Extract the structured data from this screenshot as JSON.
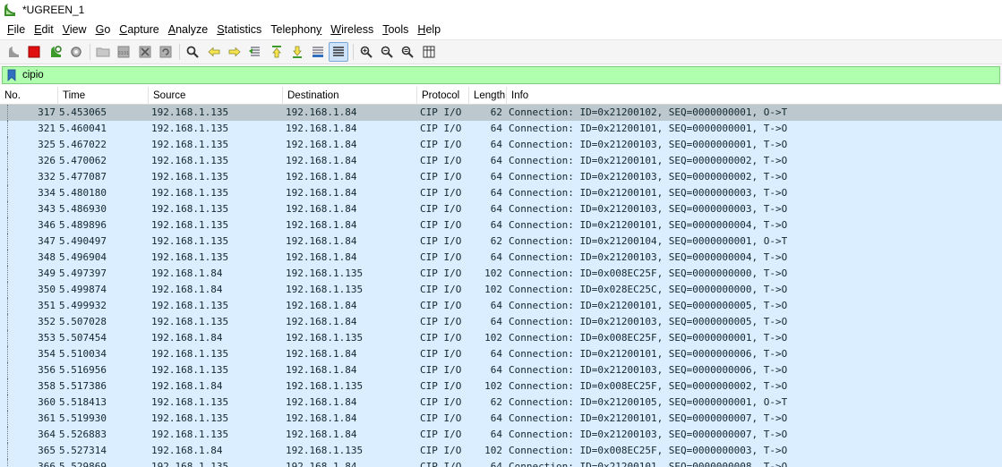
{
  "window": {
    "title": "*UGREEN_1"
  },
  "menu": [
    {
      "pre": "",
      "mn": "F",
      "post": "ile"
    },
    {
      "pre": "",
      "mn": "E",
      "post": "dit"
    },
    {
      "pre": "",
      "mn": "V",
      "post": "iew"
    },
    {
      "pre": "",
      "mn": "G",
      "post": "o"
    },
    {
      "pre": "",
      "mn": "C",
      "post": "apture"
    },
    {
      "pre": "",
      "mn": "A",
      "post": "nalyze"
    },
    {
      "pre": "",
      "mn": "S",
      "post": "tatistics"
    },
    {
      "pre": "Telephon",
      "mn": "y",
      "post": ""
    },
    {
      "pre": "",
      "mn": "W",
      "post": "ireless"
    },
    {
      "pre": "",
      "mn": "T",
      "post": "ools"
    },
    {
      "pre": "",
      "mn": "H",
      "post": "elp"
    }
  ],
  "toolbar": {
    "buttons": [
      "start-capture-icon",
      "stop-capture-icon",
      "restart-capture-icon",
      "capture-options-icon",
      "|",
      "open-file-icon",
      "save-file-icon",
      "close-file-icon",
      "reload-file-icon",
      "|",
      "find-packet-icon",
      "go-back-icon",
      "go-forward-icon",
      "go-to-packet-icon",
      "go-first-icon",
      "go-last-icon",
      "autoscroll-icon",
      "colorize-icon",
      "|",
      "zoom-in-icon",
      "zoom-out-icon",
      "zoom-normal-icon",
      "resize-columns-icon"
    ]
  },
  "filter": {
    "value": "cipio"
  },
  "columns": {
    "no": "No.",
    "time": "Time",
    "source": "Source",
    "destination": "Destination",
    "protocol": "Protocol",
    "length": "Length",
    "info": "Info"
  },
  "packets": [
    {
      "no": "317",
      "time": "5.453065",
      "src": "192.168.1.135",
      "dst": "192.168.1.84",
      "proto": "CIP I/O",
      "len": "62",
      "info": "Connection: ID=0x21200102, SEQ=0000000001, O->T"
    },
    {
      "no": "321",
      "time": "5.460041",
      "src": "192.168.1.135",
      "dst": "192.168.1.84",
      "proto": "CIP I/O",
      "len": "64",
      "info": "Connection: ID=0x21200101, SEQ=0000000001, T->O"
    },
    {
      "no": "325",
      "time": "5.467022",
      "src": "192.168.1.135",
      "dst": "192.168.1.84",
      "proto": "CIP I/O",
      "len": "64",
      "info": "Connection: ID=0x21200103, SEQ=0000000001, T->O"
    },
    {
      "no": "326",
      "time": "5.470062",
      "src": "192.168.1.135",
      "dst": "192.168.1.84",
      "proto": "CIP I/O",
      "len": "64",
      "info": "Connection: ID=0x21200101, SEQ=0000000002, T->O"
    },
    {
      "no": "332",
      "time": "5.477087",
      "src": "192.168.1.135",
      "dst": "192.168.1.84",
      "proto": "CIP I/O",
      "len": "64",
      "info": "Connection: ID=0x21200103, SEQ=0000000002, T->O"
    },
    {
      "no": "334",
      "time": "5.480180",
      "src": "192.168.1.135",
      "dst": "192.168.1.84",
      "proto": "CIP I/O",
      "len": "64",
      "info": "Connection: ID=0x21200101, SEQ=0000000003, T->O"
    },
    {
      "no": "343",
      "time": "5.486930",
      "src": "192.168.1.135",
      "dst": "192.168.1.84",
      "proto": "CIP I/O",
      "len": "64",
      "info": "Connection: ID=0x21200103, SEQ=0000000003, T->O"
    },
    {
      "no": "346",
      "time": "5.489896",
      "src": "192.168.1.135",
      "dst": "192.168.1.84",
      "proto": "CIP I/O",
      "len": "64",
      "info": "Connection: ID=0x21200101, SEQ=0000000004, T->O"
    },
    {
      "no": "347",
      "time": "5.490497",
      "src": "192.168.1.135",
      "dst": "192.168.1.84",
      "proto": "CIP I/O",
      "len": "62",
      "info": "Connection: ID=0x21200104, SEQ=0000000001, O->T"
    },
    {
      "no": "348",
      "time": "5.496904",
      "src": "192.168.1.135",
      "dst": "192.168.1.84",
      "proto": "CIP I/O",
      "len": "64",
      "info": "Connection: ID=0x21200103, SEQ=0000000004, T->O"
    },
    {
      "no": "349",
      "time": "5.497397",
      "src": "192.168.1.84",
      "dst": "192.168.1.135",
      "proto": "CIP I/O",
      "len": "102",
      "info": "Connection: ID=0x008EC25F, SEQ=0000000000, T->O"
    },
    {
      "no": "350",
      "time": "5.499874",
      "src": "192.168.1.84",
      "dst": "192.168.1.135",
      "proto": "CIP I/O",
      "len": "102",
      "info": "Connection: ID=0x028EC25C, SEQ=0000000000, T->O"
    },
    {
      "no": "351",
      "time": "5.499932",
      "src": "192.168.1.135",
      "dst": "192.168.1.84",
      "proto": "CIP I/O",
      "len": "64",
      "info": "Connection: ID=0x21200101, SEQ=0000000005, T->O"
    },
    {
      "no": "352",
      "time": "5.507028",
      "src": "192.168.1.135",
      "dst": "192.168.1.84",
      "proto": "CIP I/O",
      "len": "64",
      "info": "Connection: ID=0x21200103, SEQ=0000000005, T->O"
    },
    {
      "no": "353",
      "time": "5.507454",
      "src": "192.168.1.84",
      "dst": "192.168.1.135",
      "proto": "CIP I/O",
      "len": "102",
      "info": "Connection: ID=0x008EC25F, SEQ=0000000001, T->O"
    },
    {
      "no": "354",
      "time": "5.510034",
      "src": "192.168.1.135",
      "dst": "192.168.1.84",
      "proto": "CIP I/O",
      "len": "64",
      "info": "Connection: ID=0x21200101, SEQ=0000000006, T->O"
    },
    {
      "no": "356",
      "time": "5.516956",
      "src": "192.168.1.135",
      "dst": "192.168.1.84",
      "proto": "CIP I/O",
      "len": "64",
      "info": "Connection: ID=0x21200103, SEQ=0000000006, T->O"
    },
    {
      "no": "358",
      "time": "5.517386",
      "src": "192.168.1.84",
      "dst": "192.168.1.135",
      "proto": "CIP I/O",
      "len": "102",
      "info": "Connection: ID=0x008EC25F, SEQ=0000000002, T->O"
    },
    {
      "no": "360",
      "time": "5.518413",
      "src": "192.168.1.135",
      "dst": "192.168.1.84",
      "proto": "CIP I/O",
      "len": "62",
      "info": "Connection: ID=0x21200105, SEQ=0000000001, O->T"
    },
    {
      "no": "361",
      "time": "5.519930",
      "src": "192.168.1.135",
      "dst": "192.168.1.84",
      "proto": "CIP I/O",
      "len": "64",
      "info": "Connection: ID=0x21200101, SEQ=0000000007, T->O"
    },
    {
      "no": "364",
      "time": "5.526883",
      "src": "192.168.1.135",
      "dst": "192.168.1.84",
      "proto": "CIP I/O",
      "len": "64",
      "info": "Connection: ID=0x21200103, SEQ=0000000007, T->O"
    },
    {
      "no": "365",
      "time": "5.527314",
      "src": "192.168.1.84",
      "dst": "192.168.1.135",
      "proto": "CIP I/O",
      "len": "102",
      "info": "Connection: ID=0x008EC25F, SEQ=0000000003, T->O"
    },
    {
      "no": "366",
      "time": "5.529869",
      "src": "192.168.1.135",
      "dst": "192.168.1.84",
      "proto": "CIP I/O",
      "len": "64",
      "info": "Connection: ID=0x21200101, SEQ=0000000008, T->O"
    }
  ],
  "selected_index": 0,
  "colors": {
    "row_bg": "#daeeff",
    "row_selected_bg": "#bcc7ce",
    "filter_valid_bg": "#afffaf"
  }
}
